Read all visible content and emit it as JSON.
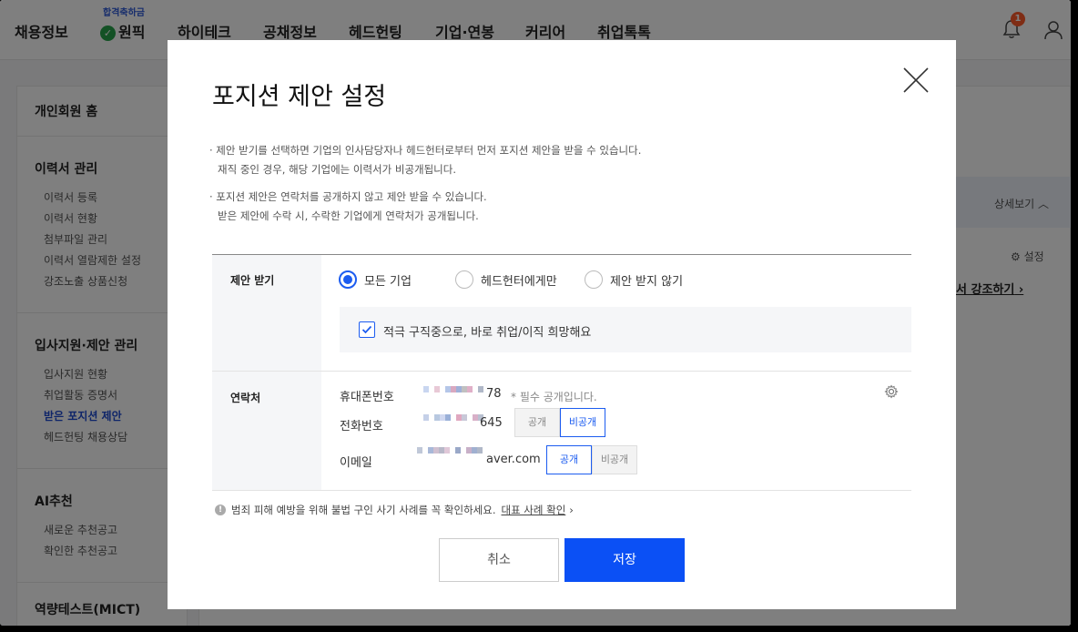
{
  "nav": {
    "items": [
      "채용정보",
      "원픽",
      "하이테크",
      "공채정보",
      "헤드헌팅",
      "기업·연봉",
      "커리어",
      "취업톡톡"
    ],
    "pick_badge": "합격축하금",
    "notification_count": "1"
  },
  "sidebar": {
    "home": "개인회원 홈",
    "resume": {
      "title": "이력서 관리",
      "items": [
        "이력서 등록",
        "이력서 현황",
        "첨부파일 관리",
        "이력서 열람제한 설정",
        "강조노출 상품신청"
      ]
    },
    "apply": {
      "title": "입사지원·제안 관리",
      "items": [
        "입사지원 현황",
        "취업활동 증명서",
        "받은 포지션 제안",
        "헤드헌팅 채용상담"
      ]
    },
    "ai": {
      "title": "AI추천",
      "items": [
        "새로운 추천공고",
        "확인한 추천공고"
      ]
    },
    "test": "역량테스트(MICT)"
  },
  "background": {
    "detail": "상세보기",
    "settings": "설정",
    "highlight": "서 강조하기"
  },
  "modal": {
    "title": "포지션 제안 설정",
    "notes": [
      [
        "· 제안 받기를 선택하면 기업의 인사담당자나 헤드헌터로부터 먼저 포지션 제안을 받을 수 있습니다.",
        "재직 중인 경우, 해당 기업에는 이력서가 비공개됩니다."
      ],
      [
        "· 포지션 제안은 연락처를 공개하지 않고 제안 받을 수 있습니다.",
        "받은 제안에 수락 시, 수락한 기업에게 연락처가 공개됩니다."
      ]
    ],
    "receive": {
      "label": "제안 받기",
      "options": [
        "모든 기업",
        "헤드헌터에게만",
        "제안 받지 않기"
      ],
      "selected": "모든 기업",
      "checkbox_label": "적극 구직중으로, 바로 취업/이직 희망해요",
      "checked": true
    },
    "contact": {
      "label": "연락처",
      "mobile": {
        "label": "휴대폰번호",
        "suffix": "78",
        "note": "* 필수 공개입니다."
      },
      "phone": {
        "label": "전화번호",
        "suffix": "645",
        "selected": "비공개"
      },
      "email": {
        "label": "이메일",
        "suffix": "aver.com",
        "selected": "공개"
      },
      "public_label": "공개",
      "private_label": "비공개"
    },
    "warning": {
      "text": "범죄 피해 예방을 위해 불법 구인 사기 사례를 꼭 확인하세요.",
      "link": "대표 사례 확인"
    },
    "buttons": {
      "cancel": "취소",
      "save": "저장"
    }
  }
}
